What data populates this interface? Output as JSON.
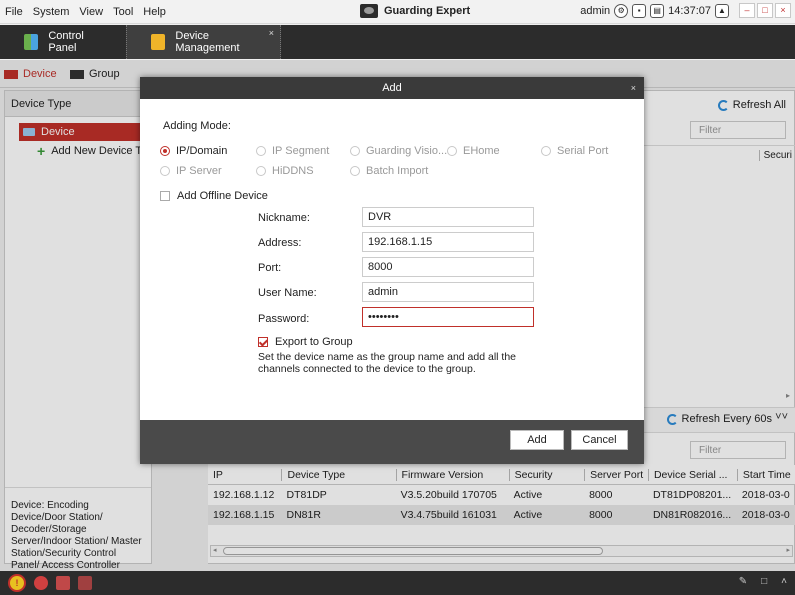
{
  "menubar": {
    "items": [
      "File",
      "System",
      "View",
      "Tool",
      "Help"
    ],
    "app_title": "Guarding Expert",
    "user": "admin",
    "time": "14:37:07",
    "win_buttons": [
      "–",
      "□",
      "×"
    ]
  },
  "tabs": {
    "control_panel": "Control Panel",
    "device_management": "Device Management",
    "close": "×"
  },
  "subtabs": {
    "device": "Device",
    "group": "Group"
  },
  "left_panel": {
    "header": "Device Type",
    "selected": "Device",
    "add_new": "Add New Device Ty",
    "description": "Device: Encoding Device/Door Station/ Decoder/Storage Server/Indoor Station/ Master Station/Security Control Panel/ Access Controller"
  },
  "right_panel": {
    "refresh_all": "Refresh All",
    "filter_placeholder": "Filter",
    "security_col": "Securi",
    "refresh_every": "Refresh Every 60s",
    "collapse": "»",
    "filter_bottom": "Filter"
  },
  "online_table": {
    "columns": [
      "IP",
      "Device Type",
      "Firmware Version",
      "Security",
      "Server Port",
      "Device Serial ...",
      "Start Time"
    ],
    "rows": [
      [
        "192.168.1.12",
        "DT81DP",
        "V3.5.20build 170705",
        "Active",
        "8000",
        "DT81DP08201...",
        "2018-03-0"
      ],
      [
        "192.168.1.15",
        "DN81R",
        "V3.4.75build 161031",
        "Active",
        "8000",
        "DN81R082016...",
        "2018-03-0"
      ]
    ]
  },
  "dialog": {
    "title": "Add",
    "close": "×",
    "adding_mode_label": "Adding Mode:",
    "modes": [
      "IP/Domain",
      "IP Segment",
      "Guarding Visio...",
      "EHome",
      "Serial Port",
      "IP Server",
      "HiDDNS",
      "Batch Import"
    ],
    "add_offline": "Add Offline Device",
    "fields": {
      "nickname_label": "Nickname:",
      "nickname": "DVR",
      "address_label": "Address:",
      "address": "192.168.1.15",
      "port_label": "Port:",
      "port": "8000",
      "username_label": "User Name:",
      "username": "admin",
      "password_label": "Password:",
      "password": "••••••••"
    },
    "export_group": "Export to Group",
    "hint": "Set the device name as the group name and add all the channels connected to the device to the group.",
    "add_button": "Add",
    "cancel_button": "Cancel"
  },
  "colors": {
    "accent": "#c0302a",
    "dark_bar": "#2c2c2c",
    "dialog_title": "#3a3a3a"
  }
}
